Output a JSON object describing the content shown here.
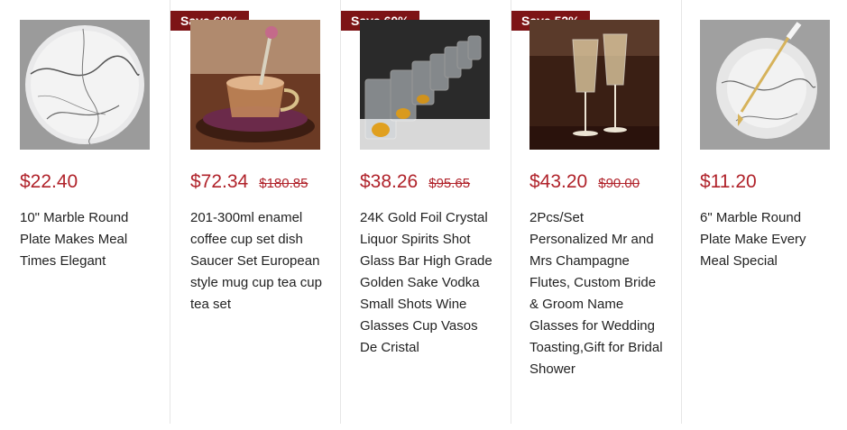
{
  "products": [
    {
      "price": "$22.40",
      "original_price": "",
      "badge": "",
      "title": "10\" Marble Round Plate Makes Meal Times Elegant"
    },
    {
      "price": "$72.34",
      "original_price": "$180.85",
      "badge": "Save 60%",
      "title": "201-300ml enamel coffee cup set dish Saucer Set European style mug cup tea cup tea set"
    },
    {
      "price": "$38.26",
      "original_price": "$95.65",
      "badge": "Save 60%",
      "title": "24K Gold Foil Crystal Liquor Spirits Shot Glass Bar High Grade Golden Sake Vodka Small Shots Wine Glasses Cup Vasos De Cristal"
    },
    {
      "price": "$43.20",
      "original_price": "$90.00",
      "badge": "Save 52%",
      "title": "2Pcs/Set Personalized Mr and Mrs Champagne Flutes, Custom Bride & Groom Name Glasses for Wedding Toasting,Gift for Bridal Shower"
    },
    {
      "price": "$11.20",
      "original_price": "",
      "badge": "",
      "title": "6\" Marble Round Plate Make Every Meal Special"
    }
  ],
  "colors": {
    "badge": "#7d1416",
    "price": "#b0222a"
  }
}
